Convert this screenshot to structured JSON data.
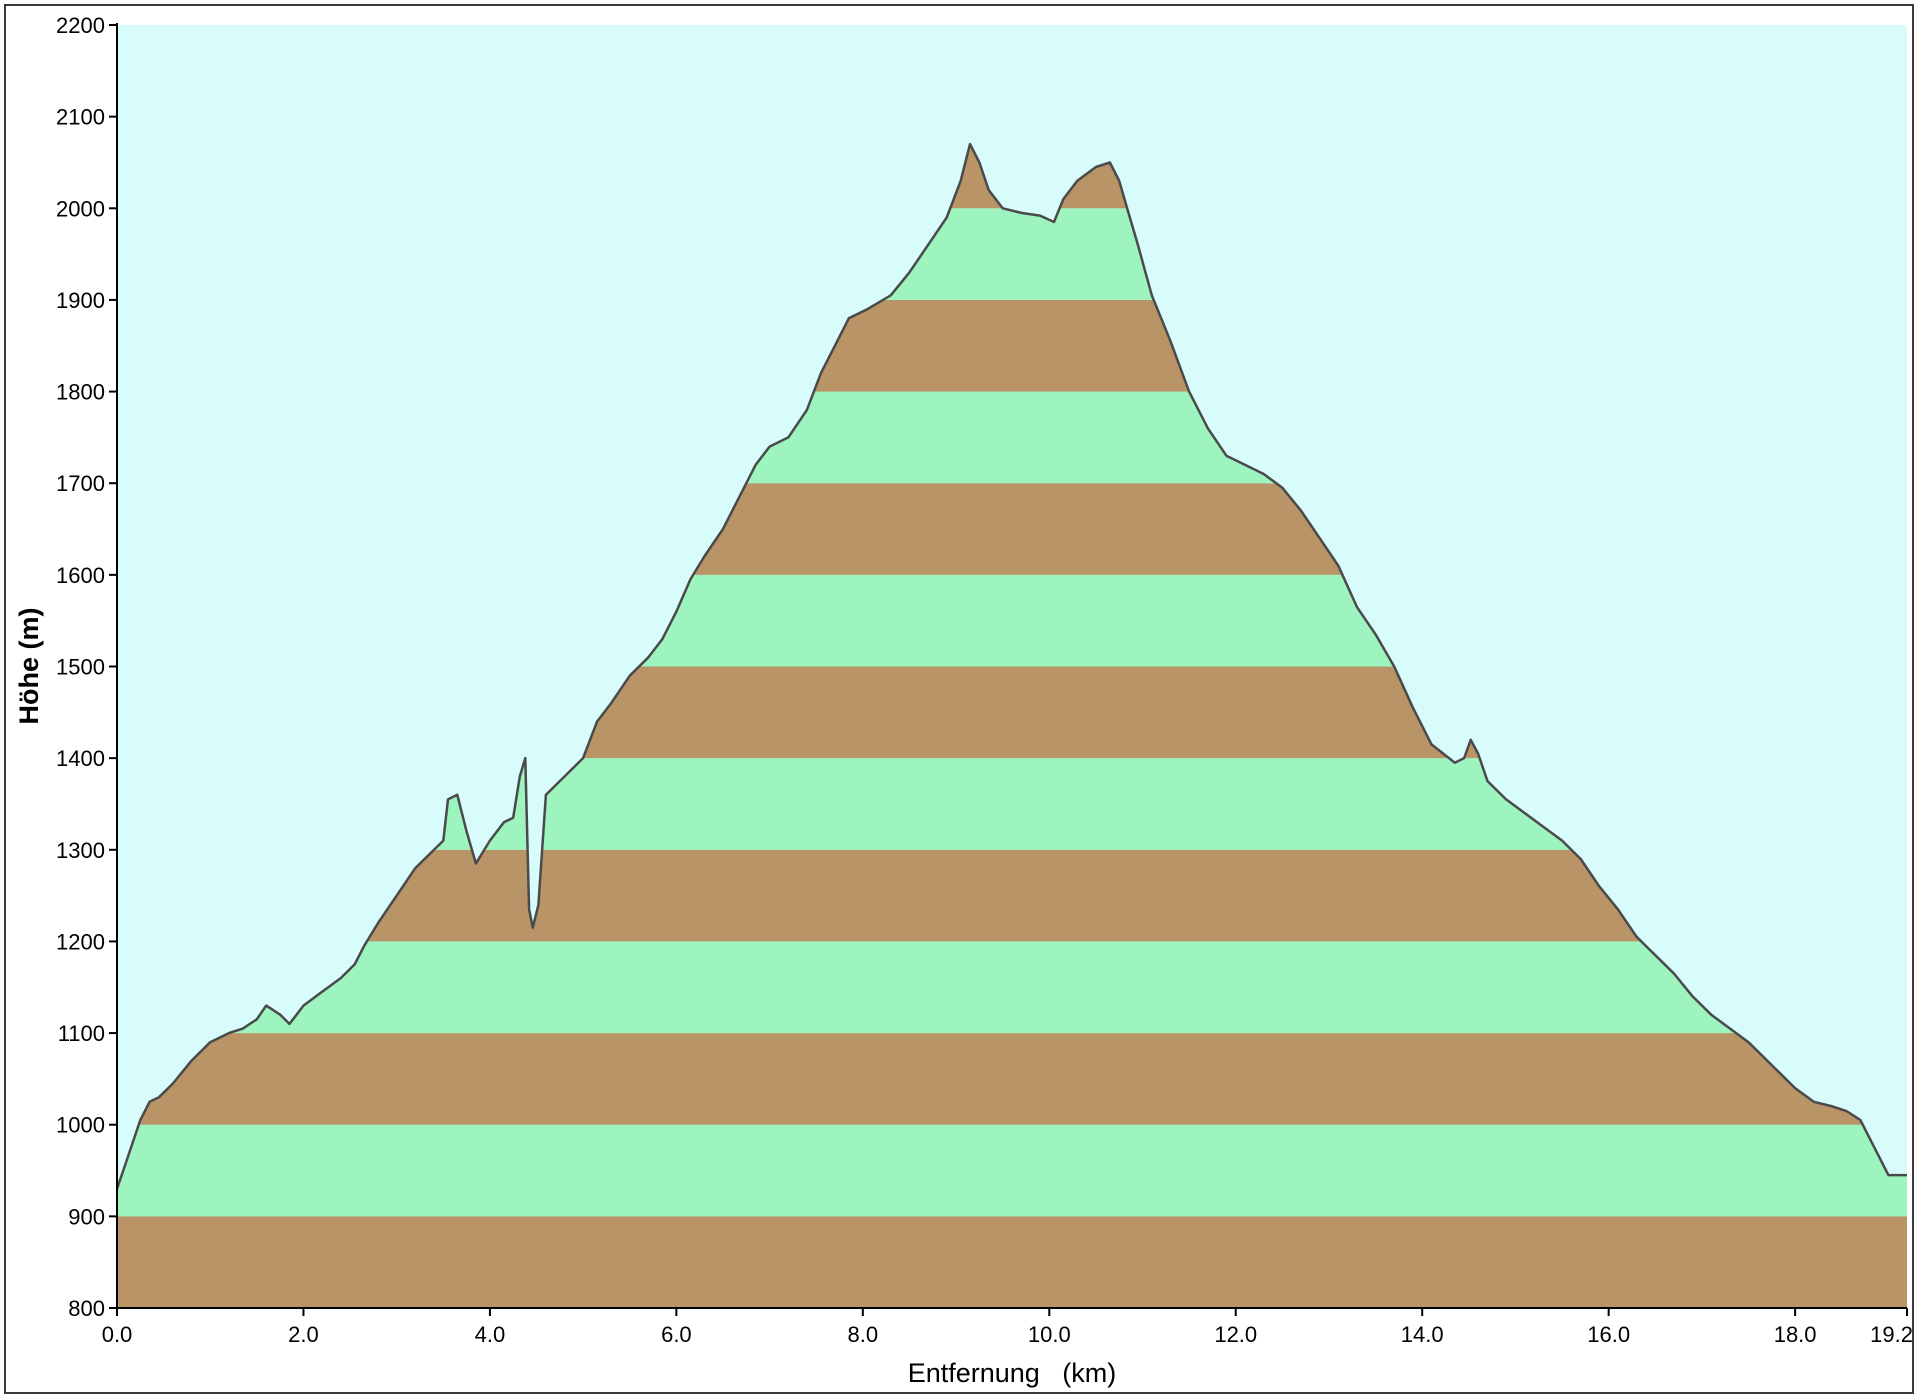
{
  "chart_data": {
    "type": "area",
    "title": "",
    "xlabel": "Entfernung   (km)",
    "ylabel": "Höhe (m)",
    "xlim": [
      0.0,
      19.2
    ],
    "ylim": [
      800,
      2200
    ],
    "x_ticks": [
      "0.0",
      "2.0",
      "4.0",
      "6.0",
      "8.0",
      "10.0",
      "12.0",
      "14.0",
      "16.0",
      "18.0",
      "19.2"
    ],
    "x_tick_values": [
      0,
      2,
      4,
      6,
      8,
      10,
      12,
      14,
      16,
      18,
      19.2
    ],
    "y_ticks": [
      "800",
      "900",
      "1000",
      "1100",
      "1200",
      "1300",
      "1400",
      "1500",
      "1600",
      "1700",
      "1800",
      "1900",
      "2000",
      "2100",
      "2200"
    ],
    "y_tick_values": [
      800,
      900,
      1000,
      1100,
      1200,
      1300,
      1400,
      1500,
      1600,
      1700,
      1800,
      1900,
      2000,
      2100,
      2200
    ],
    "grid": false,
    "band_interval_m": 100,
    "colors": {
      "sky": "#d8fcfc",
      "band_brown": "#b99467",
      "band_green": "#9df4be",
      "profile_line": "#4a4a4a"
    },
    "series": [
      {
        "x": [
          0.0,
          0.05,
          0.15,
          0.25,
          0.35,
          0.45,
          0.6,
          0.8,
          1.0,
          1.2,
          1.35,
          1.5,
          1.6,
          1.75,
          1.85,
          2.0,
          2.2,
          2.4,
          2.55,
          2.65,
          2.8,
          3.0,
          3.2,
          3.35,
          3.5,
          3.55,
          3.65,
          3.75,
          3.85,
          4.0,
          4.15,
          4.25,
          4.32,
          4.38,
          4.42,
          4.46,
          4.52,
          4.6,
          4.8,
          5.0,
          5.15,
          5.3,
          5.5,
          5.7,
          5.85,
          6.0,
          6.15,
          6.3,
          6.5,
          6.7,
          6.85,
          7.0,
          7.2,
          7.4,
          7.55,
          7.7,
          7.85,
          8.05,
          8.3,
          8.5,
          8.7,
          8.9,
          9.05,
          9.15,
          9.25,
          9.35,
          9.5,
          9.7,
          9.9,
          10.05,
          10.15,
          10.3,
          10.5,
          10.65,
          10.75,
          10.85,
          10.95,
          11.1,
          11.3,
          11.5,
          11.7,
          11.9,
          12.1,
          12.3,
          12.5,
          12.7,
          12.9,
          13.1,
          13.3,
          13.5,
          13.7,
          13.9,
          14.1,
          14.35,
          14.45,
          14.52,
          14.6,
          14.7,
          14.9,
          15.1,
          15.3,
          15.5,
          15.7,
          15.9,
          16.1,
          16.3,
          16.5,
          16.7,
          16.9,
          17.1,
          17.3,
          17.5,
          17.7,
          17.85,
          18.0,
          18.2,
          18.4,
          18.55,
          18.7,
          18.85,
          19.0,
          19.2
        ],
        "y": [
          930,
          945,
          975,
          1005,
          1025,
          1030,
          1045,
          1070,
          1090,
          1100,
          1105,
          1115,
          1130,
          1120,
          1110,
          1130,
          1145,
          1160,
          1175,
          1195,
          1220,
          1250,
          1280,
          1295,
          1310,
          1355,
          1360,
          1320,
          1285,
          1310,
          1330,
          1335,
          1380,
          1400,
          1235,
          1215,
          1240,
          1360,
          1380,
          1400,
          1440,
          1460,
          1490,
          1510,
          1530,
          1560,
          1595,
          1620,
          1650,
          1690,
          1720,
          1740,
          1750,
          1780,
          1820,
          1850,
          1880,
          1890,
          1905,
          1930,
          1960,
          1990,
          2030,
          2070,
          2050,
          2020,
          2000,
          1995,
          1992,
          1985,
          2010,
          2030,
          2045,
          2050,
          2030,
          1995,
          1960,
          1905,
          1855,
          1800,
          1760,
          1730,
          1720,
          1710,
          1695,
          1670,
          1640,
          1610,
          1565,
          1535,
          1500,
          1455,
          1415,
          1395,
          1400,
          1420,
          1405,
          1375,
          1355,
          1340,
          1325,
          1310,
          1290,
          1260,
          1235,
          1205,
          1185,
          1165,
          1140,
          1120,
          1105,
          1090,
          1070,
          1055,
          1040,
          1025,
          1020,
          1015,
          1005,
          975,
          945,
          945
        ]
      }
    ]
  }
}
